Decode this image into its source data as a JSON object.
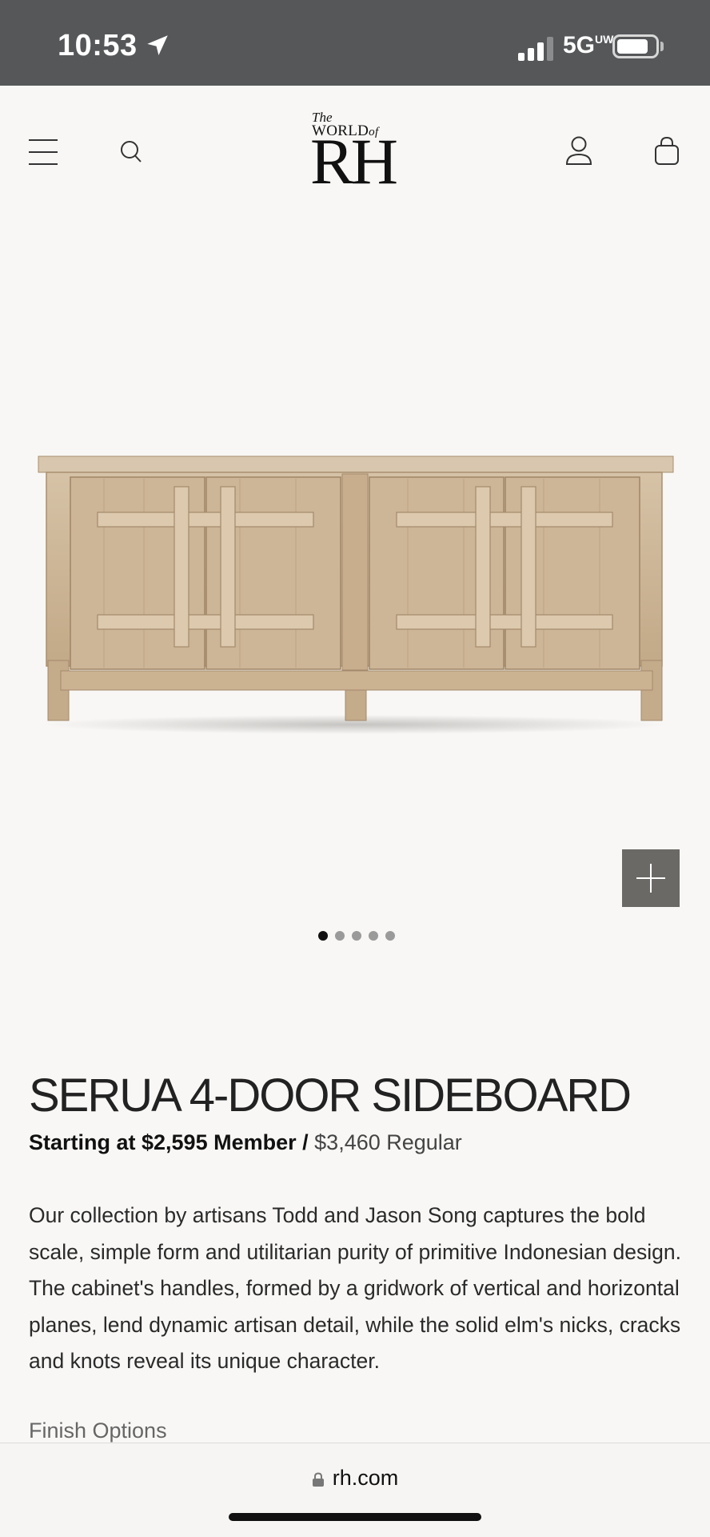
{
  "status_bar": {
    "time": "10:53",
    "network": "5G",
    "network_suffix": "UW"
  },
  "header": {
    "logo": {
      "the": "The",
      "world": "WORLD",
      "of": "of",
      "brand": "RH"
    }
  },
  "gallery": {
    "image_count": 5,
    "active_index": 0
  },
  "product": {
    "title": "SERUA 4-DOOR SIDEBOARD",
    "price_prefix": "Starting at $2,595 Member /",
    "price_regular": "$3,460 Regular",
    "description": "Our collection by artisans Todd and Jason Song captures the bold scale, simple form and utilitarian purity of primitive Indonesian design. The cabinet's handles, formed by a gridwork of vertical and horizontal planes, lend dynamic artisan detail, while the solid elm's nicks, cracks and knots reveal its unique character.",
    "finish_label": "Finish Options"
  },
  "browser": {
    "url": "rh.com"
  },
  "colors": {
    "status_bar_bg": "#555759",
    "page_bg": "#f8f7f5",
    "wood": "#c9b194",
    "zoom_button_bg": "#6b6966"
  }
}
